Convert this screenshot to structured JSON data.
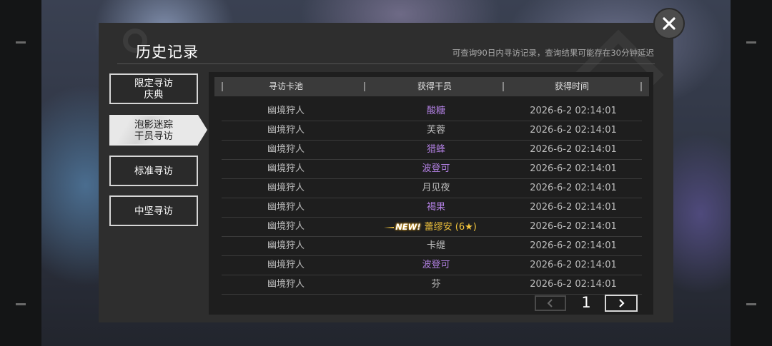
{
  "title": "历史记录",
  "note": "可查询90日内寻访记录，查询结果可能存在30分钟延迟",
  "close_icon": "close-icon",
  "tabs": [
    {
      "line1": "限定寻访",
      "line2": "庆典",
      "active": false
    },
    {
      "line1": "泡影迷踪",
      "line2": "干员寻访",
      "active": true
    },
    {
      "line1": "标准寻访",
      "line2": "",
      "active": false
    },
    {
      "line1": "中坚寻访",
      "line2": "",
      "active": false
    }
  ],
  "table": {
    "headers": [
      "寻访卡池",
      "获得干员",
      "获得时间"
    ],
    "rows": [
      {
        "pool": "幽境狩人",
        "operator": "酸糖",
        "rarity": "rare4",
        "time": "2026-6-2 02:14:01"
      },
      {
        "pool": "幽境狩人",
        "operator": "芙蓉",
        "rarity": "rare3",
        "time": "2026-6-2 02:14:01"
      },
      {
        "pool": "幽境狩人",
        "operator": "猎蜂",
        "rarity": "rare4",
        "time": "2026-6-2 02:14:01"
      },
      {
        "pool": "幽境狩人",
        "operator": "波登可",
        "rarity": "rare4",
        "time": "2026-6-2 02:14:01"
      },
      {
        "pool": "幽境狩人",
        "operator": "月见夜",
        "rarity": "rare3",
        "time": "2026-6-2 02:14:01"
      },
      {
        "pool": "幽境狩人",
        "operator": "褐果",
        "rarity": "rare4",
        "time": "2026-6-2 02:14:01"
      },
      {
        "pool": "幽境狩人",
        "operator": "蕾缪安 (6★)",
        "rarity": "rare6",
        "new": "NEW!",
        "time": "2026-6-2 02:14:01"
      },
      {
        "pool": "幽境狩人",
        "operator": "卡缇",
        "rarity": "rare3",
        "time": "2026-6-2 02:14:01"
      },
      {
        "pool": "幽境狩人",
        "operator": "波登可",
        "rarity": "rare4",
        "time": "2026-6-2 02:14:01"
      },
      {
        "pool": "幽境狩人",
        "operator": "芬",
        "rarity": "rare3",
        "time": "2026-6-2 02:14:01"
      }
    ]
  },
  "pager": {
    "page": "1",
    "prev_icon": "chevron-left-icon",
    "next_icon": "chevron-right-icon"
  },
  "colors": {
    "rare4": "#b07fe0",
    "rare6": "#f2c43c",
    "panel": "#2e2e2e"
  }
}
